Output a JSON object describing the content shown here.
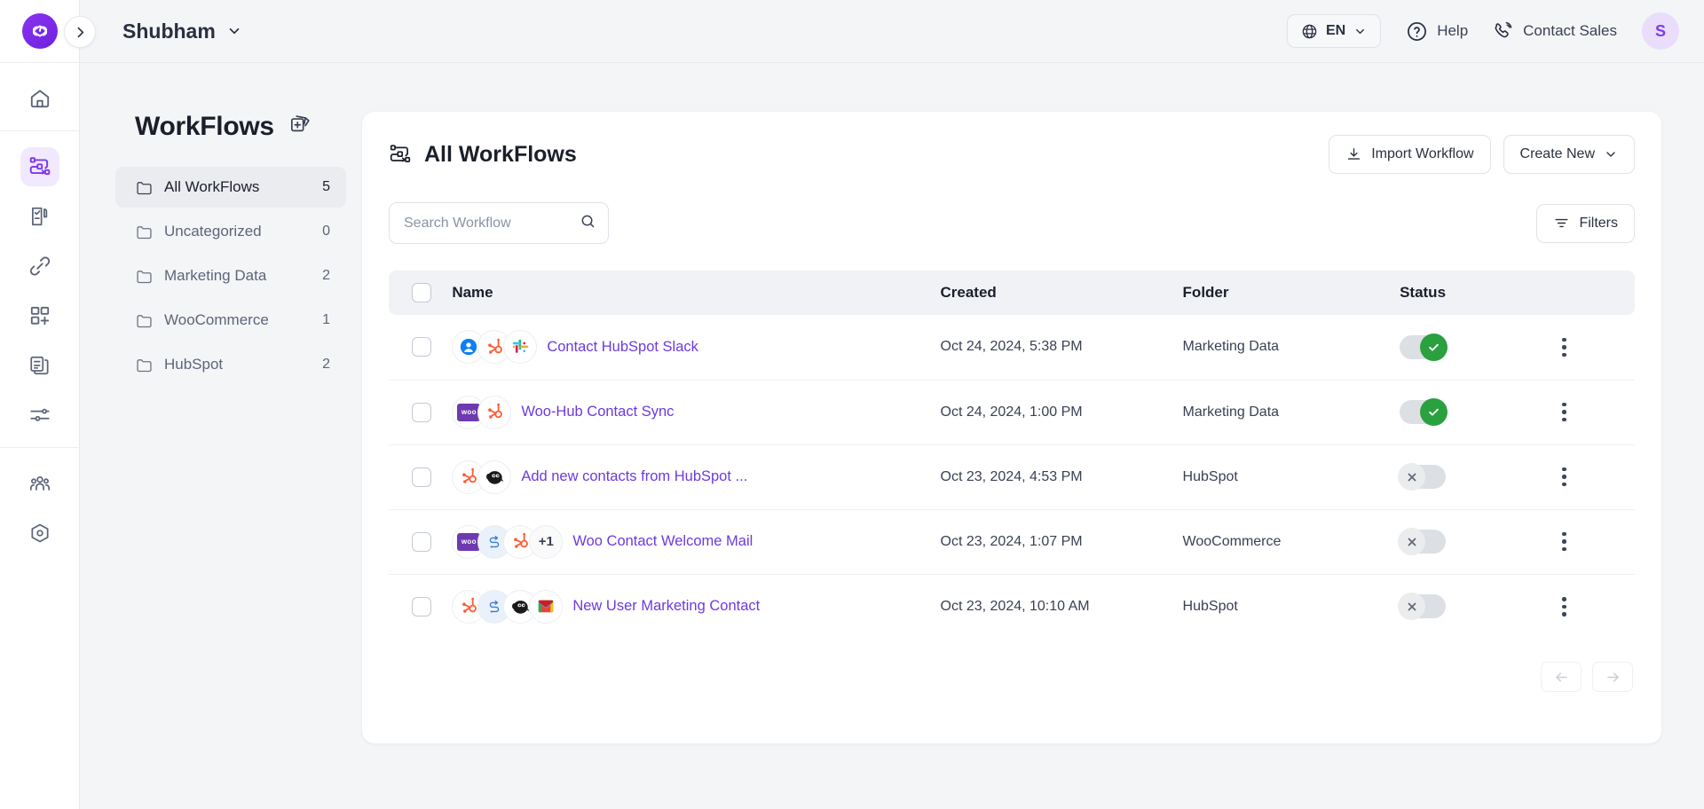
{
  "topbar": {
    "workspace_name": "Shubham",
    "language": "EN",
    "help_label": "Help",
    "contact_sales_label": "Contact Sales",
    "avatar_initial": "S"
  },
  "rail": {
    "items": [
      {
        "icon": "home-icon",
        "name": "sidebar-item-home",
        "active": false
      },
      {
        "icon": "workflow-icon",
        "name": "sidebar-item-workflows",
        "active": true
      },
      {
        "icon": "form-icon",
        "name": "sidebar-item-forms",
        "active": false
      },
      {
        "icon": "link-icon",
        "name": "sidebar-item-connections",
        "active": false
      },
      {
        "icon": "grid-plus-icon",
        "name": "sidebar-item-apps",
        "active": false
      },
      {
        "icon": "documents-icon",
        "name": "sidebar-item-templates",
        "active": false
      },
      {
        "icon": "sliders-icon",
        "name": "sidebar-item-settings",
        "active": false
      },
      {
        "icon": "team-icon",
        "name": "sidebar-item-team",
        "active": false
      },
      {
        "icon": "target-icon",
        "name": "sidebar-item-support",
        "active": false
      }
    ]
  },
  "folders_panel": {
    "title": "WorkFlows",
    "add_folder_icon": "add-folder-icon",
    "items": [
      {
        "label": "All WorkFlows",
        "count": "5",
        "active": true
      },
      {
        "label": "Uncategorized",
        "count": "0",
        "active": false
      },
      {
        "label": "Marketing Data",
        "count": "2",
        "active": false
      },
      {
        "label": "WooCommerce",
        "count": "1",
        "active": false
      },
      {
        "label": "HubSpot",
        "count": "2",
        "active": false
      }
    ]
  },
  "card": {
    "title": "All WorkFlows",
    "import_label": "Import Workflow",
    "create_label": "Create New",
    "filters_label": "Filters",
    "search": {
      "value": "",
      "placeholder": "Search Workflow"
    }
  },
  "table": {
    "headers": [
      "Name",
      "Created",
      "Folder",
      "Status"
    ],
    "rows": [
      {
        "name": "Contact HubSpot Slack",
        "created": "Oct 24, 2024, 5:38 PM",
        "folder": "Marketing Data",
        "status": "on",
        "apps": [
          "contact-icon",
          "hubspot-icon",
          "slack-icon"
        ],
        "extra": ""
      },
      {
        "name": "Woo-Hub Contact Sync",
        "created": "Oct 24, 2024, 1:00 PM",
        "folder": "Marketing Data",
        "status": "on",
        "apps": [
          "woocommerce-icon",
          "hubspot-icon"
        ],
        "extra": ""
      },
      {
        "name": "Add new contacts from HubSpot ...",
        "created": "Oct 23, 2024, 4:53 PM",
        "folder": "HubSpot",
        "status": "off",
        "apps": [
          "hubspot-icon",
          "mailchimp-icon"
        ],
        "extra": ""
      },
      {
        "name": "Woo Contact Welcome Mail",
        "created": "Oct 23, 2024, 1:07 PM",
        "folder": "WooCommerce",
        "status": "off",
        "apps": [
          "woocommerce-icon",
          "router-icon",
          "hubspot-icon"
        ],
        "extra": "+1"
      },
      {
        "name": "New User Marketing Contact",
        "created": "Oct 23, 2024, 10:10 AM",
        "folder": "HubSpot",
        "status": "off",
        "apps": [
          "hubspot-icon",
          "router-icon",
          "mailchimp-icon",
          "gmail-icon"
        ],
        "extra": ""
      }
    ]
  },
  "pagination": {
    "prev_icon": "arrow-left-icon",
    "next_icon": "arrow-right-icon"
  },
  "colors": {
    "brand_purple": "#7c3aed",
    "link_purple": "#6d3ae0",
    "status_on_green": "#2ba03f",
    "hubspot_orange": "#ff5c35",
    "woo_purple": "#6d3ab0"
  }
}
